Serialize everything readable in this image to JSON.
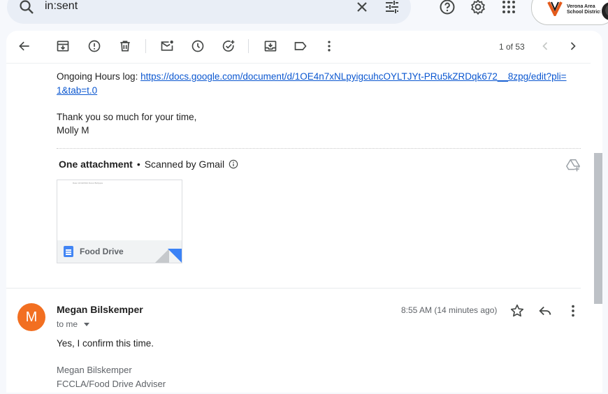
{
  "search": {
    "query": "in:sent"
  },
  "org": {
    "name": "Verona Area School District"
  },
  "toolbar": {
    "pager": "1 of 53"
  },
  "message1": {
    "hours_label": "Ongoing Hours log: ",
    "hours_link_line1": "https://docs.google.com/document/d/1OE4n7xNLpyigcuhcOYLTJYt-PRu5kZRDqk672__8zpg/edit?pli=",
    "hours_link_line2": "1&tab=t.0",
    "thanks": "Thank you so much for your time,",
    "signoff": "Molly M"
  },
  "attachments": {
    "title": "One attachment",
    "bullet": "•",
    "scanned": "Scanned by Gmail",
    "file_name": "Food Drive",
    "preview_text": "Date 11/19/2024 Donut Bullyspa"
  },
  "message2": {
    "avatar_letter": "M",
    "sender": "Megan Bilskemper",
    "to": "to me",
    "time": "8:55 AM (14 minutes ago)",
    "body": "Yes, I confirm this time.",
    "sig_name": "Megan Bilskemper",
    "sig_title": "FCCLA/Food Drive Adviser"
  },
  "colors": {
    "link": "#0b57d0",
    "avatar": "#f26f21",
    "accent": "#0b57d0"
  },
  "icons": [
    "search-icon",
    "clear-icon",
    "tune-icon",
    "help-icon",
    "settings-icon",
    "apps-icon",
    "back-arrow-icon",
    "archive-icon",
    "report-spam-icon",
    "delete-icon",
    "mark-unread-icon",
    "snooze-icon",
    "add-task-icon",
    "move-to-icon",
    "label-icon",
    "more-vert-icon",
    "chevron-left-icon",
    "chevron-right-icon",
    "info-icon",
    "add-to-drive-icon",
    "star-icon",
    "reply-icon"
  ]
}
